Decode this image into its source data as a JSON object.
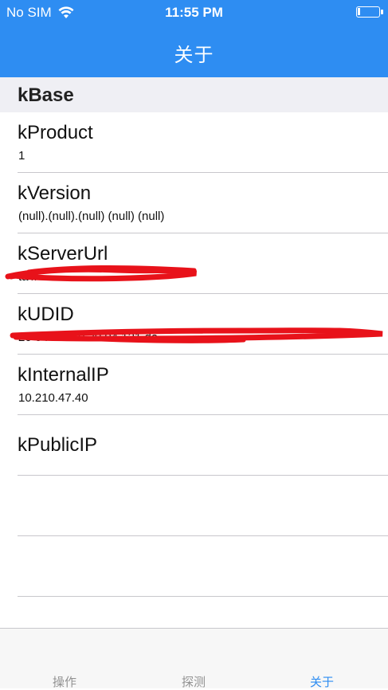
{
  "status_bar": {
    "carrier": "No SIM",
    "time": "11:55 PM",
    "wifi_icon": "wifi-icon",
    "battery_icon": "battery-icon"
  },
  "nav": {
    "title": "关于"
  },
  "section": {
    "title": "kBase"
  },
  "rows": [
    {
      "title": "kProduct",
      "value": "1"
    },
    {
      "title": "kVersion",
      "value": "(null).(null).(null) (null) (null)"
    },
    {
      "title": "kServerUrl",
      "value": "ta  //   "
    },
    {
      "title": "kUDID",
      "value": "20  04  0   3a  0  30   04    121    da"
    },
    {
      "title": "kInternalIP",
      "value": "10.210.47.40"
    },
    {
      "title": "kPublicIP",
      "value": ""
    },
    {
      "title": "",
      "value": ""
    },
    {
      "title": "",
      "value": ""
    }
  ],
  "redaction_color": "#e8121a",
  "tabs": [
    {
      "label": "操作",
      "active": false
    },
    {
      "label": "探测",
      "active": false
    },
    {
      "label": "关于",
      "active": true
    }
  ],
  "colors": {
    "accent": "#2e8df2",
    "section_bg": "#efeff4"
  }
}
